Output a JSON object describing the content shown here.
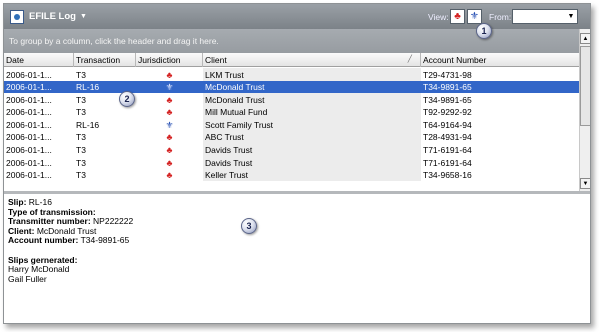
{
  "window": {
    "title": "EFILE Log",
    "view_label": "View:",
    "from_label": "From:",
    "from_value": ""
  },
  "group_panel": {
    "hint": "To group by a column, click the header and drag it here."
  },
  "grid": {
    "columns": [
      "Date",
      "Transaction",
      "Jurisdiction",
      "Client",
      "Account Number"
    ],
    "rows": [
      {
        "date": "2006-01-1...",
        "transaction": "T3",
        "jurisdiction": "canada",
        "client": "LKM Trust",
        "account": "T29-4731-98",
        "selected": false
      },
      {
        "date": "2006-01-1...",
        "transaction": "RL-16",
        "jurisdiction": "quebec",
        "client": "McDonald Trust",
        "account": "T34-9891-65",
        "selected": true
      },
      {
        "date": "2006-01-1...",
        "transaction": "T3",
        "jurisdiction": "canada",
        "client": "McDonald Trust",
        "account": "T34-9891-65",
        "selected": false
      },
      {
        "date": "2006-01-1...",
        "transaction": "T3",
        "jurisdiction": "canada",
        "client": "Mill Mutual Fund",
        "account": "T92-9292-92",
        "selected": false
      },
      {
        "date": "2006-01-1...",
        "transaction": "RL-16",
        "jurisdiction": "quebec",
        "client": "Scott Family Trust",
        "account": "T64-9164-94",
        "selected": false
      },
      {
        "date": "2006-01-1...",
        "transaction": "T3",
        "jurisdiction": "canada",
        "client": "ABC Trust",
        "account": "T28-4931-94",
        "selected": false
      },
      {
        "date": "2006-01-1...",
        "transaction": "T3",
        "jurisdiction": "canada",
        "client": "Davids Trust",
        "account": "T71-6191-64",
        "selected": false
      },
      {
        "date": "2006-01-1...",
        "transaction": "T3",
        "jurisdiction": "canada",
        "client": "Davids Trust",
        "account": "T71-6191-64",
        "selected": false
      },
      {
        "date": "2006-01-1...",
        "transaction": "T3",
        "jurisdiction": "canada",
        "client": "Keller Trust",
        "account": "T34-9658-16",
        "selected": false
      }
    ]
  },
  "details": {
    "slip_label": "Slip:",
    "slip_value": "RL-16",
    "type_label": "Type of transmission:",
    "transmitter_label": "Transmitter number:",
    "transmitter_value": "NP222222",
    "client_label": "Client:",
    "client_value": "McDonald Trust",
    "account_label": "Account number:",
    "account_value": "T34-9891-65",
    "slips_label": "Slips gernerated:",
    "slips": [
      "Harry McDonald",
      "Gail Fuller"
    ]
  },
  "callouts": [
    "1",
    "2",
    "3"
  ],
  "icons": {
    "canada": "maple-leaf-icon",
    "quebec": "fleur-de-lis-icon"
  },
  "colors": {
    "selection": "#3266c8",
    "canada_flag": "#d42020",
    "quebec_flag": "#1e48b0",
    "titlebar": "#8a9096"
  }
}
